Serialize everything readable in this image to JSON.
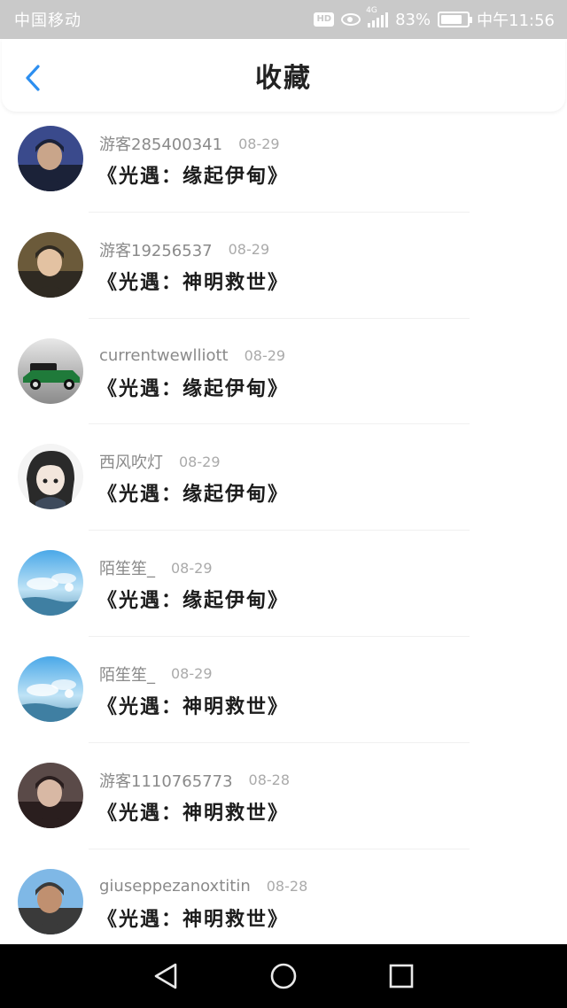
{
  "status_bar": {
    "carrier": "中国移动",
    "hd": "HD",
    "network": "4G",
    "battery_percent": "83%",
    "battery_level": 0.83,
    "time": "中午11:56"
  },
  "header": {
    "title": "收藏",
    "accent_color": "#2d8ff0"
  },
  "items": [
    {
      "username": "游客285400341",
      "date": "08-29",
      "title": "《光遇：缘起伊甸》",
      "avatar": "avatar-photo"
    },
    {
      "username": "游客19256537",
      "date": "08-29",
      "title": "《光遇：神明救世》",
      "avatar": "avatar-photo"
    },
    {
      "username": "currentwewlliott",
      "date": "08-29",
      "title": "《光遇：缘起伊甸》",
      "avatar": "avatar-car"
    },
    {
      "username": "西风吹灯",
      "date": "08-29",
      "title": "《光遇：缘起伊甸》",
      "avatar": "avatar-anime"
    },
    {
      "username": "陌笙笙_",
      "date": "08-29",
      "title": "《光遇：缘起伊甸》",
      "avatar": "avatar-sky"
    },
    {
      "username": "陌笙笙_",
      "date": "08-29",
      "title": "《光遇：神明救世》",
      "avatar": "avatar-sky"
    },
    {
      "username": "游客1110765773",
      "date": "08-28",
      "title": "《光遇：神明救世》",
      "avatar": "avatar-photo"
    },
    {
      "username": "giuseppezanoxtitin",
      "date": "08-28",
      "title": "《光遇：神明救世》",
      "avatar": "avatar-photo"
    }
  ],
  "nav": {
    "back": "back-triangle-icon",
    "home": "home-circle-icon",
    "recents": "recents-square-icon"
  }
}
